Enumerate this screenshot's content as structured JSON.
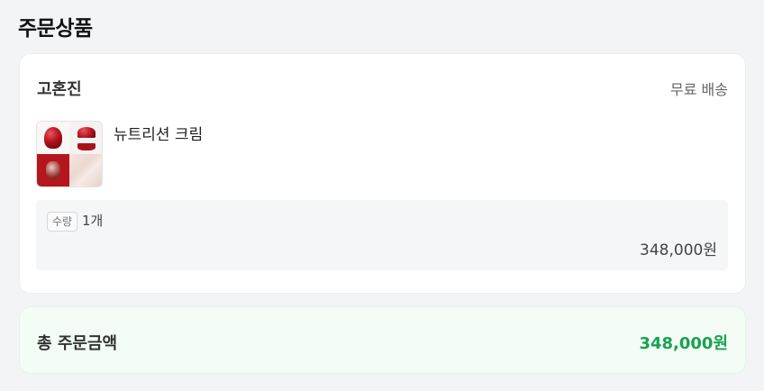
{
  "section": {
    "title": "주문상품"
  },
  "order": {
    "seller_name": "고혼진",
    "shipping_label": "무료 배송",
    "product": {
      "name": "뉴트리션 크림",
      "thumbnail_icon": "product-thumbnail"
    },
    "quantity_label": "수량",
    "quantity_value": "1개",
    "line_price": "348,000원"
  },
  "total": {
    "label": "총 주문금액",
    "value": "348,000원",
    "color": "#1aa150"
  },
  "colors": {
    "background": "#f3f4f6",
    "card": "#ffffff",
    "total_card": "#f3fcf5",
    "accent": "#1aa150"
  }
}
